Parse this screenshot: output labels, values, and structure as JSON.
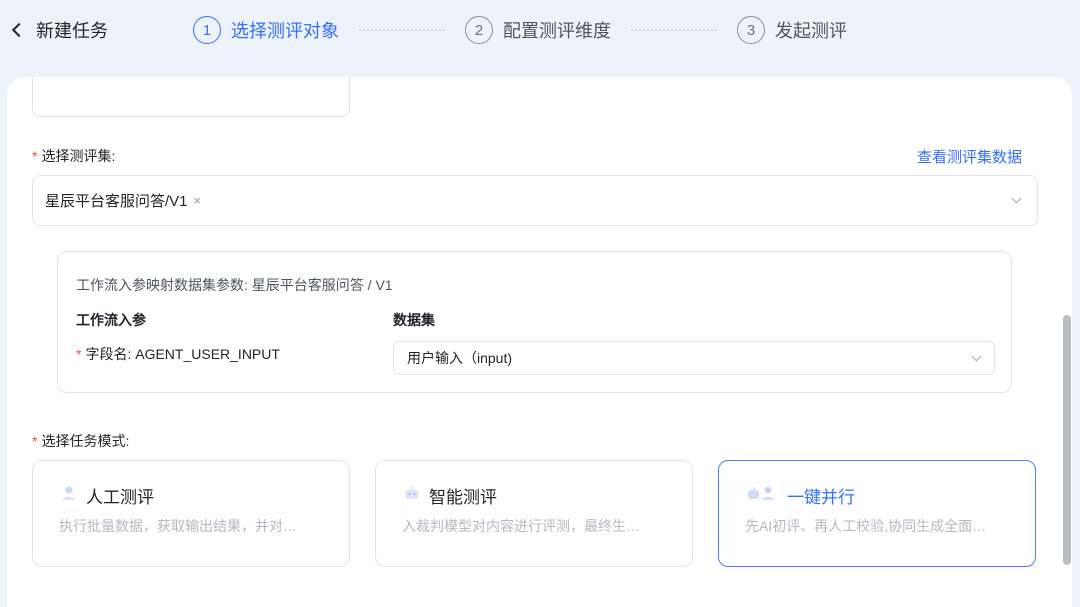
{
  "header": {
    "back_title": "新建任务",
    "steps": [
      {
        "num": "1",
        "label": "选择测评对象"
      },
      {
        "num": "2",
        "label": "配置测评维度"
      },
      {
        "num": "3",
        "label": "发起测评"
      }
    ]
  },
  "form": {
    "required_mark": "*",
    "eval_set_label": "选择测评集:",
    "view_link": "查看测评集数据",
    "selected_tag": "星辰平台客服问答/V1",
    "tag_remove": "×",
    "mapping": {
      "title": "工作流入参映射数据集参数: 星辰平台客服问答 / V1",
      "col_input": "工作流入参",
      "col_dataset": "数据集",
      "field_name": "字段名: AGENT_USER_INPUT",
      "dataset_value": "用户输入（input)"
    },
    "mode_label": "选择任务模式:",
    "modes": [
      {
        "name": "人工测评",
        "desc": "执行批量数据，获取输出结果，并对…"
      },
      {
        "name": "智能测评",
        "desc": "入裁判模型对内容进行评测，最终生…"
      },
      {
        "name": "一键并行",
        "desc": "先AI初评、再人工校验,协同生成全面…"
      }
    ]
  },
  "colors": {
    "accent": "#3370ff",
    "required": "#f54a45",
    "page_bg": "#eef2fb"
  }
}
